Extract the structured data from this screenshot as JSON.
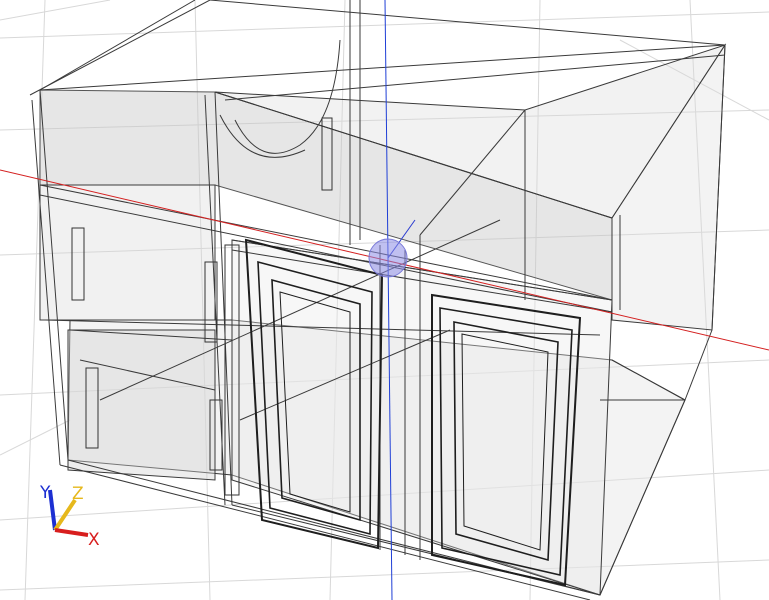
{
  "viewport": {
    "description_hidden": false,
    "background_color": "#ffffff",
    "grid_color": "#d8d8d8",
    "model_line_color": "#3a3a3a",
    "model_fill_color": "#c8c8c8"
  },
  "axes": {
    "red_axis_color": "#d42020",
    "blue_axis_color": "#1f3fd6",
    "pivot_color": "#8c8ce6"
  },
  "triad": {
    "x_label": "X",
    "y_label": "Y",
    "z_label": "Z",
    "x_color": "#d81e1e",
    "y_color": "#1c2fd2",
    "z_color": "#e6b81c"
  }
}
